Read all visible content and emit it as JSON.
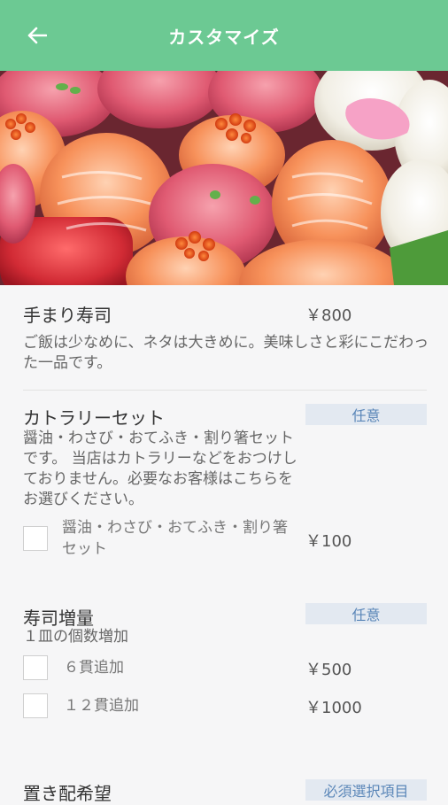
{
  "header": {
    "title": "カスタマイズ"
  },
  "product": {
    "name": "手まり寿司",
    "price": "￥800",
    "description": "ご飯は少なめに、ネタは大きめに。美味しさと彩にこだわった一品です。"
  },
  "sections": [
    {
      "title": "カトラリーセット",
      "badge": "任意",
      "description": "醤油・わさび・おてふき・割り箸セットです。 当店はカトラリーなどをおつけしておりません。必要なお客様はこちらをお選びください。",
      "options": [
        {
          "label": "醤油・わさび・おてふき・割り箸セット",
          "price": "￥100"
        }
      ]
    },
    {
      "title": "寿司増量",
      "badge": "任意",
      "description": "１皿の個数増加",
      "options": [
        {
          "label": "６貫追加",
          "price": "￥500"
        },
        {
          "label": "１２貫追加",
          "price": "￥1000"
        }
      ]
    },
    {
      "title": "置き配希望",
      "badge": "必須選択項目"
    }
  ],
  "colors": {
    "appbar": "#6cc993",
    "badge_bg": "#e3e9f1",
    "badge_text": "#5a86b8"
  }
}
